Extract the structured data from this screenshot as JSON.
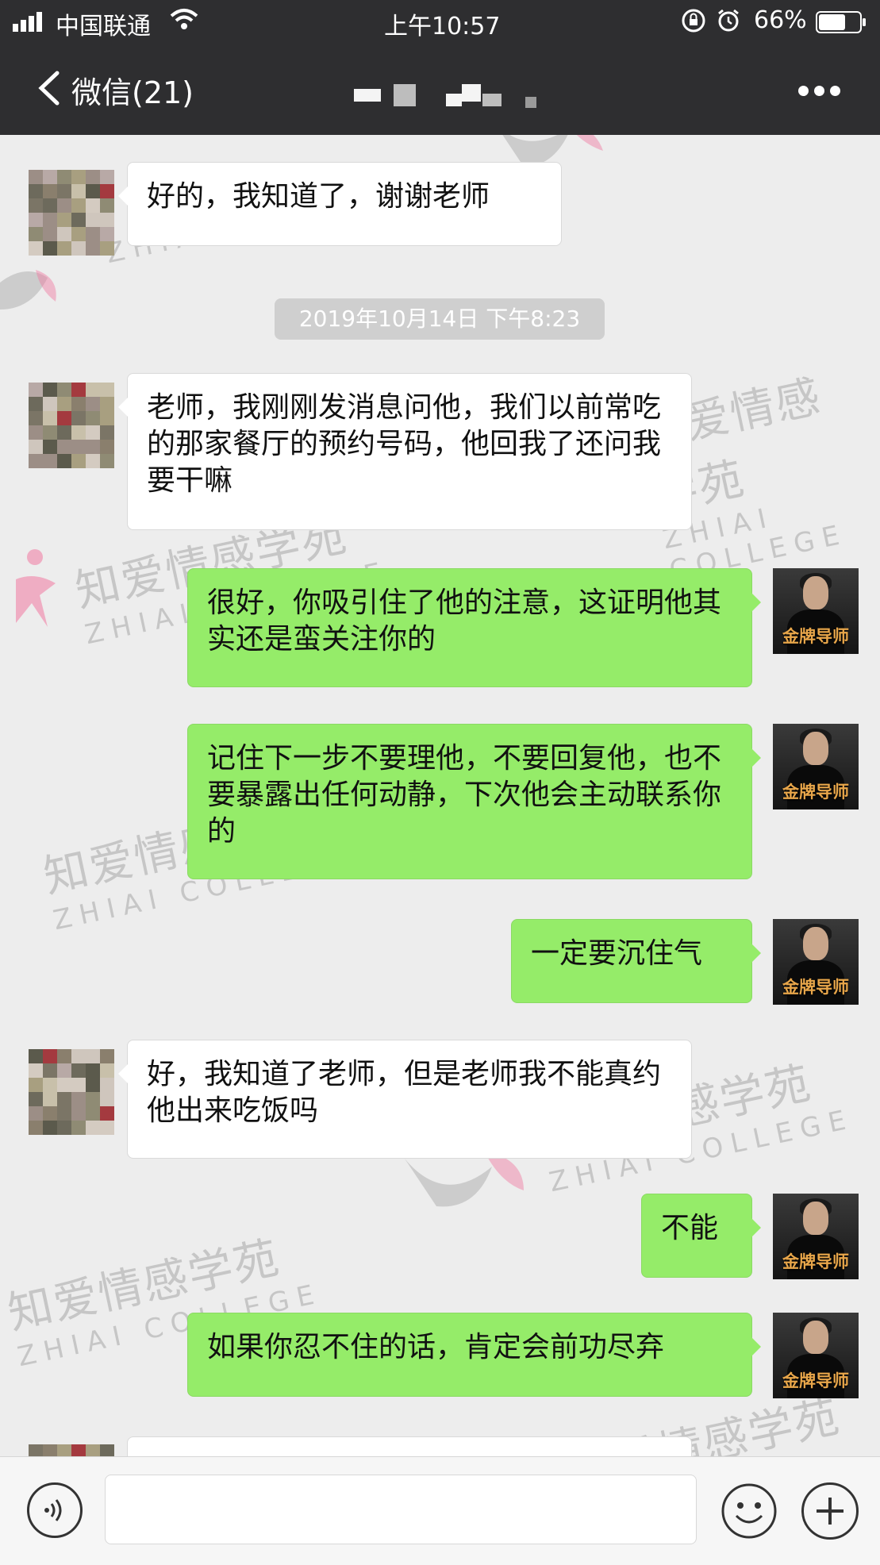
{
  "status_bar": {
    "carrier": "中国联通",
    "time": "上午10:57",
    "battery_percent": "66%",
    "battery_level": 0.66,
    "icons": [
      "signal-icon",
      "wifi-icon",
      "orientation-lock-icon",
      "alarm-icon",
      "battery-icon"
    ]
  },
  "nav": {
    "back_label": "微信(21)",
    "back_icon": "chevron-left-icon",
    "more_icon": "more-dots-icon"
  },
  "watermark": {
    "cn": "知爱情感学苑",
    "en": "ZHIAI COLLEGE"
  },
  "chat": {
    "timestamp": "2019年10月14日 下午8:23",
    "messages": [
      {
        "side": "left",
        "text": "好的，我知道了，谢谢老师"
      },
      {
        "side": "left",
        "text": "老师，我刚刚发消息问他，我们以前常吃的那家餐厅的预约号码，他回我了还问我要干嘛"
      },
      {
        "side": "right",
        "text": "很好，你吸引住了他的注意，这证明他其实还是蛮关注你的"
      },
      {
        "side": "right",
        "text": "记住下一步不要理他，不要回复他，也不要暴露出任何动静，下次他会主动联系你的"
      },
      {
        "side": "right",
        "text": "一定要沉住气"
      },
      {
        "side": "left",
        "text": "好，我知道了老师，但是老师我不能真约他出来吃饭吗"
      },
      {
        "side": "right",
        "text": "不能"
      },
      {
        "side": "right",
        "text": "如果你忍不住的话，肯定会前功尽弃"
      }
    ],
    "teacher_avatar_badge": "金牌导师"
  },
  "input_bar": {
    "voice_icon": "voice-icon",
    "emoji_icon": "emoji-icon",
    "plus_icon": "plus-icon",
    "value": ""
  },
  "colors": {
    "header_bg": "#2e2e30",
    "chat_bg": "#ededed",
    "right_bubble": "#95ec69",
    "left_bubble": "#ffffff"
  }
}
